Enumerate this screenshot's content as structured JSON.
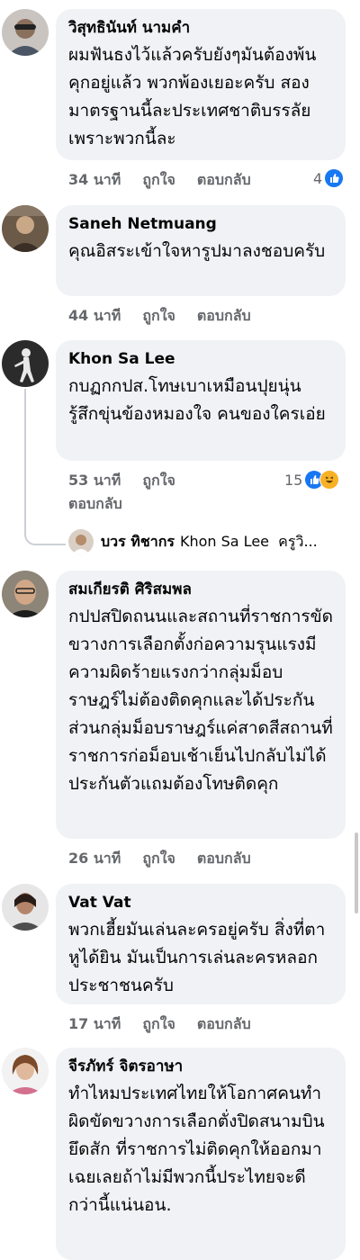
{
  "actions": {
    "like": "ถูกใจ",
    "reply": "ตอบกลับ"
  },
  "comments": [
    {
      "name": "วิสุทธินันท์ นามคำ",
      "text": "ผมฟันธงไว้แล้วครับยังๆมันต้องพ้นคุกอยู่แล้ว พวกพ้องเยอะครับ สองมาตรฐานนี้ละประเทศชาติบรรลัยเพราะพวกนี้ละ",
      "time": "34 นาที",
      "reactions": "4"
    },
    {
      "name": "Saneh Netmuang",
      "text": "คุณอิสระเข้าใจหารูปมาลงชอบครับ",
      "time": "44 นาที"
    },
    {
      "name": "Khon Sa Lee",
      "text": "กบฏกกปส.โทษเบาเหมือนปุยนุ่น รู้สึกขุ่นข้องหมองใจ คนของใครเอ่ย",
      "time": "53 นาที",
      "reactions": "15"
    },
    {
      "name": "สมเกียรติ ศิริสมพล",
      "text": "กปปสปิดถนนและสถานที่ราชการขัดขวางการเลือกตั้งก่อความรุนแรงมีความผิดร้ายแรงกว่ากลุ่มม็อบราษฎร์ไม่ต้องติดคุกและได้ประกันส่วนกลุ่มม็อบราษฎร์แค่สาดสีสถานที่ราชการก่อม็อบเช้าเย็นไปกลับไม่ได้ประกันตัวแถมต้องโทษติดคุก",
      "time": "26 นาที"
    },
    {
      "name": "Vat Vat",
      "text": "พวกเฮี้ยมันเล่นละครอยู่ครับ สิ่งที่ตา หูได้ยิน มันเป็นการเล่นละครหลอกประชาชนครับ",
      "time": "17 นาที"
    },
    {
      "name": "จีรภัทร์ จิตรอาษา",
      "text": "ทำไหมประเทศไทยให้โอกาศคนทำผิดขัดขวางการเลือกตั่งปิดสนามบินยึดสัก ที่ราชการไม่ติดคุกให้ออกมาเฉยเลยถ้าไม่มีพวกนี้ประไทยจะดีกว่านี้แน่นอน."
    }
  ],
  "reply_preview": {
    "name": "บวร ทิชากร",
    "text": "Khon Sa Lee  ครูวิ..."
  },
  "colors": {
    "bubble": "#f0f2f5",
    "meta": "#65676b",
    "like": "#1877f2"
  }
}
